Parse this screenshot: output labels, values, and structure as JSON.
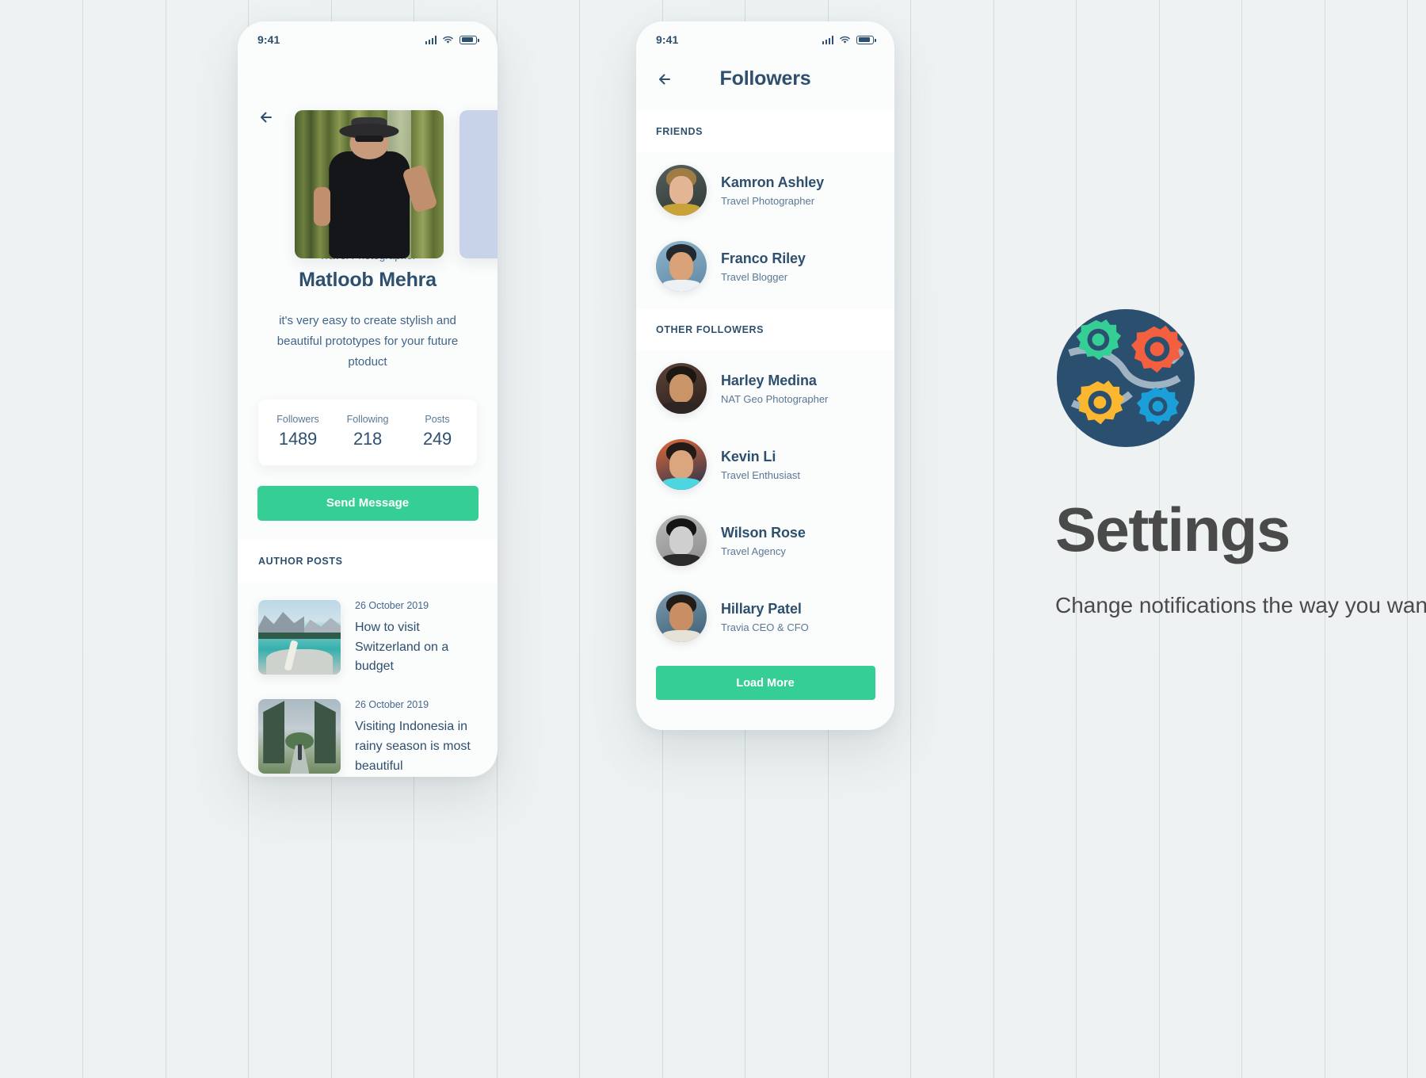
{
  "status_bar": {
    "time": "9:41",
    "signal_icon": "cellular-signal-icon",
    "wifi_icon": "wifi-icon",
    "battery_icon": "battery-icon"
  },
  "profile_screen": {
    "back_icon": "back-arrow-icon",
    "role": "Travel Photographer",
    "name": "Matloob Mehra",
    "bio": "it's very easy to create stylish and beautiful prototypes for your future ptoduct",
    "stats": [
      {
        "label": "Followers",
        "value": "1489"
      },
      {
        "label": "Following",
        "value": "218"
      },
      {
        "label": "Posts",
        "value": "249"
      }
    ],
    "cta_label": "Send Message",
    "posts_section_label": "AUTHOR POSTS",
    "posts": [
      {
        "date": "26 October 2019",
        "title": "How to visit Switzerland on a budget",
        "thumb": "lake-mountains-photo"
      },
      {
        "date": "26 October 2019",
        "title": "Visiting Indonesia in rainy season is most beautiful",
        "thumb": "bali-gate-photo"
      }
    ]
  },
  "followers_screen": {
    "back_icon": "back-arrow-icon",
    "title": "Followers",
    "sections": [
      {
        "label": "FRIENDS",
        "people": [
          {
            "name": "Kamron Ashley",
            "role": "Travel Photographer",
            "avatar": "avatar-kamron"
          },
          {
            "name": "Franco Riley",
            "role": "Travel Blogger",
            "avatar": "avatar-franco"
          }
        ]
      },
      {
        "label": "OTHER FOLLOWERS",
        "people": [
          {
            "name": "Harley Medina",
            "role": "NAT Geo Photographer",
            "avatar": "avatar-harley"
          },
          {
            "name": "Kevin Li",
            "role": "Travel Enthusiast",
            "avatar": "avatar-kevin"
          },
          {
            "name": "Wilson Rose",
            "role": "Travel Agency",
            "avatar": "avatar-wilson"
          },
          {
            "name": "Hillary Patel",
            "role": "Travia CEO & CFO",
            "avatar": "avatar-hillary"
          }
        ]
      }
    ],
    "load_more_label": "Load More"
  },
  "settings_panel": {
    "icon": "gears-globe-icon",
    "title": "Settings",
    "description": "Change notifications the way you want to be on Reizen so"
  },
  "colors": {
    "accent_green": "#35cf95",
    "text_dark_blue": "#2e4f6e",
    "text_muted_blue": "#5a7894",
    "page_background": "#eef2f2",
    "card_background": "#ffffff",
    "phone_background": "#fbfcfc"
  }
}
